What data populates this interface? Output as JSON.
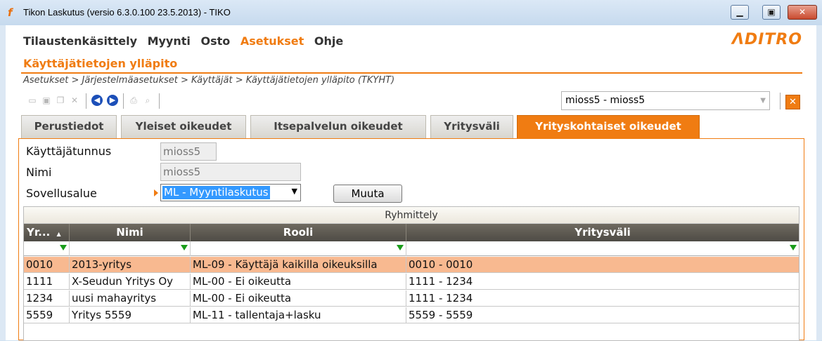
{
  "window": {
    "title": "Tikon Laskutus (versio 6.3.0.100 23.5.2013) - TIKO",
    "app_icon": "f",
    "min": "▁",
    "max": "▣",
    "close": "✕"
  },
  "menu": {
    "items": [
      "Tilaustenkäsittely",
      "Myynti",
      "Osto",
      "Asetukset",
      "Ohje"
    ],
    "active": "Asetukset"
  },
  "logo": "ΛDITRO",
  "page_title": "Käyttäjätietojen ylläpito",
  "breadcrumb": "Asetukset > Järjestelmäasetukset > Käyttäjät > Käyttäjätietojen ylläpito  (TKYHT)",
  "toolbar": {
    "icons": [
      "new-icon",
      "save-icon",
      "copy-icon",
      "delete-icon",
      "back-icon",
      "forward-icon",
      "print-icon",
      "print-preview-icon"
    ],
    "back": "◀",
    "forward": "▶"
  },
  "user_combo": {
    "value": "mioss5 - mioss5",
    "arrow": "▼"
  },
  "close_button": "✕",
  "tabs": [
    "Perustiedot",
    "Yleiset oikeudet",
    "Itsepalvelun oikeudet",
    "Yritysväli",
    "Yrityskohtaiset oikeudet"
  ],
  "active_tab": "Yrityskohtaiset oikeudet",
  "form": {
    "username_label": "Käyttäjätunnus",
    "username_value": "mioss5",
    "name_label": "Nimi",
    "name_value": "mioss5",
    "area_label": "Sovellusalue",
    "area_value": "ML - Myyntilaskutus",
    "area_arrow": "▼",
    "change_button": "Muuta"
  },
  "grid": {
    "grouping_label": "Ryhmittely",
    "columns": [
      "Yr...",
      "Nimi",
      "Rooli",
      "Yritysväli"
    ],
    "sort_indicator": "▲",
    "rows": [
      [
        "0010",
        "2013-yritys",
        "ML-09 - Käyttäjä kaikilla oikeuksilla",
        "0010 - 0010"
      ],
      [
        "1111",
        "X-Seudun Yritys Oy",
        "ML-00 - Ei oikeutta",
        "1111 - 1234"
      ],
      [
        "1234",
        "uusi mahayritys",
        "ML-00 - Ei oikeutta",
        "1111 - 1234"
      ],
      [
        "5559",
        "Yritys 5559",
        "ML-11 - tallentaja+lasku",
        "5559 - 5559"
      ]
    ],
    "selected_row": 0
  },
  "colors": {
    "accent": "#f07c12",
    "selected_row": "#f8b990",
    "header": "#5a564e"
  }
}
